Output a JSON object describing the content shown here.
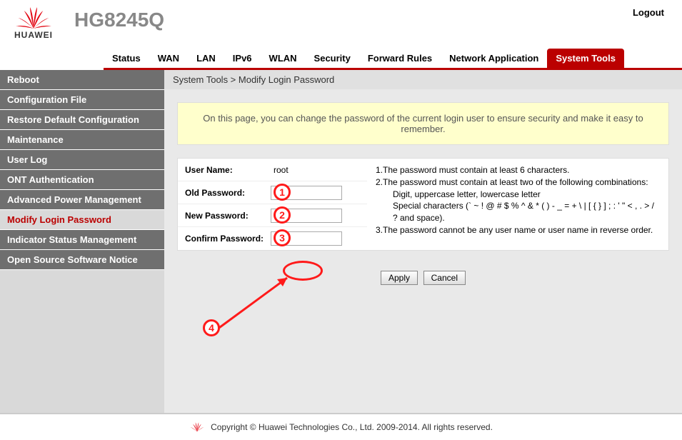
{
  "brand": "HUAWEI",
  "model": "HG8245Q",
  "logout": "Logout",
  "topnav": [
    {
      "label": "Status"
    },
    {
      "label": "WAN"
    },
    {
      "label": "LAN"
    },
    {
      "label": "IPv6"
    },
    {
      "label": "WLAN"
    },
    {
      "label": "Security"
    },
    {
      "label": "Forward Rules"
    },
    {
      "label": "Network Application"
    },
    {
      "label": "System Tools"
    }
  ],
  "topnav_active": 8,
  "sidebar": [
    {
      "label": "Reboot"
    },
    {
      "label": "Configuration File"
    },
    {
      "label": "Restore Default Configuration"
    },
    {
      "label": "Maintenance"
    },
    {
      "label": "User Log"
    },
    {
      "label": "ONT Authentication"
    },
    {
      "label": "Advanced Power Management"
    },
    {
      "label": "Modify Login Password"
    },
    {
      "label": "Indicator Status Management"
    },
    {
      "label": "Open Source Software Notice"
    }
  ],
  "sidebar_active": 7,
  "breadcrumb": "System Tools > Modify Login Password",
  "info": "On this page, you can change the password of the current login user to ensure security and make it easy to remember.",
  "form": {
    "username_label": "User Name:",
    "username_value": "root",
    "old_label": "Old Password:",
    "new_label": "New Password:",
    "confirm_label": "Confirm Password:"
  },
  "rules": {
    "r1": "1.The password must contain at least 6 characters.",
    "r2": "2.The password must contain at least two of the following combinations:",
    "r2a": "Digit, uppercase letter, lowercase letter",
    "r2b": "Special characters (` ~ ! @ # $ % ^ & * ( ) - _ = + \\ | [ { } ] ; : ' \" < , . > / ? and space).",
    "r3": "3.The password cannot be any user name or user name in reverse order."
  },
  "buttons": {
    "apply": "Apply",
    "cancel": "Cancel"
  },
  "footer": "Copyright © Huawei Technologies Co., Ltd. 2009-2014. All rights reserved.",
  "annotations": {
    "a1": "1",
    "a2": "2",
    "a3": "3",
    "a4": "4"
  }
}
